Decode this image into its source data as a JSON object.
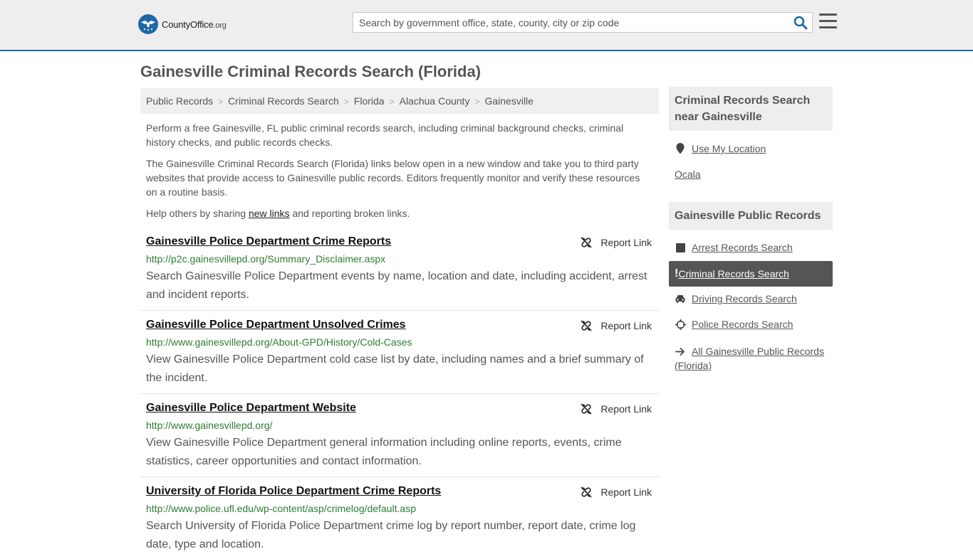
{
  "header": {
    "logo_text": "CountyOffice",
    "logo_tld": ".org",
    "search_placeholder": "Search by government office, state, county, city or zip code"
  },
  "page": {
    "title": "Gainesville Criminal Records Search (Florida)"
  },
  "breadcrumb": [
    "Public Records",
    "Criminal Records Search",
    "Florida",
    "Alachua County",
    "Gainesville"
  ],
  "intro": {
    "p1": "Perform a free Gainesville, FL public criminal records search, including criminal background checks, criminal history checks, and public records checks.",
    "p2": "The Gainesville Criminal Records Search (Florida) links below open in a new window and take you to third party websites that provide access to Gainesville public records. Editors frequently monitor and verify these resources on a routine basis.",
    "p3_before": "Help others by sharing ",
    "p3_link": "new links",
    "p3_after": " and reporting broken links."
  },
  "results": [
    {
      "title": "Gainesville Police Department Crime Reports",
      "url": "http://p2c.gainesvillepd.org/Summary_Disclaimer.aspx",
      "desc": "Search Gainesville Police Department events by name, location and date, including accident, arrest and incident reports.",
      "report": "Report Link"
    },
    {
      "title": "Gainesville Police Department Unsolved Crimes",
      "url": "http://www.gainesvillepd.org/About-GPD/History/Cold-Cases",
      "desc": "View Gainesville Police Department cold case list by date, including names and a brief summary of the incident.",
      "report": "Report Link"
    },
    {
      "title": "Gainesville Police Department Website",
      "url": "http://www.gainesvillepd.org/",
      "desc": "View Gainesville Police Department general information including online reports, events, crime statistics, career opportunities and contact information.",
      "report": "Report Link"
    },
    {
      "title": "University of Florida Police Department Crime Reports",
      "url": "http://www.police.ufl.edu/wp-content/asp/crimelog/default.asp",
      "desc": "Search University of Florida Police Department crime log by report number, report date, crime log date, type and location.",
      "report": "Report Link"
    }
  ],
  "sidebar": {
    "nearby_heading": "Criminal Records Search near Gainesville",
    "use_location": "Use My Location",
    "nearby_city": "Ocala",
    "records_heading": "Gainesville Public Records",
    "links": [
      {
        "label": "Arrest Records Search",
        "icon": "square-icon"
      },
      {
        "label": "Criminal Records Search",
        "icon": "exclamation-icon",
        "active": true
      },
      {
        "label": "Driving Records Search",
        "icon": "car-icon"
      },
      {
        "label": "Police Records Search",
        "icon": "crosshair-icon"
      },
      {
        "label": "All Gainesville Public Records (Florida)",
        "icon": "arrow-right-icon"
      }
    ]
  },
  "colors": {
    "brand": "#1f68a8",
    "url_green": "#2e7d32",
    "active_bg": "#555555"
  }
}
